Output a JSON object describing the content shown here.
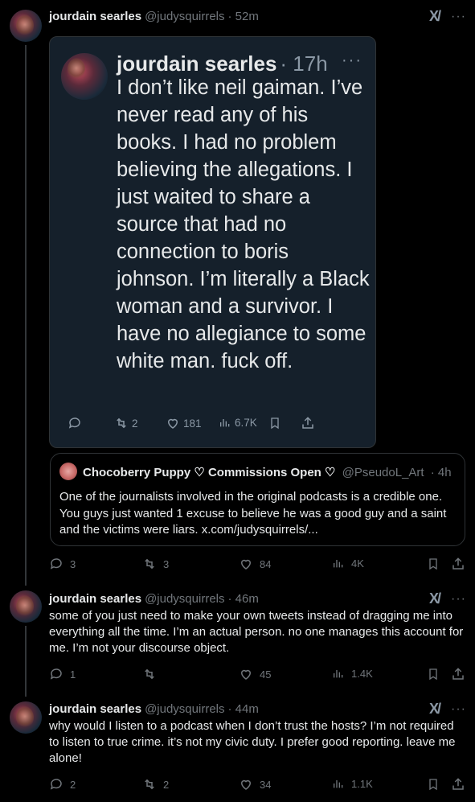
{
  "tweet1": {
    "name": "jourdain searles",
    "handle": "@judysquirrels",
    "time": "· 52m",
    "screenshot": {
      "name": "jourdain searles",
      "time": "· 17h",
      "text": "I don’t like neil gaiman. I’ve never read any of his books. I had no problem believing the allegations. I just waited to share a source that had no connection to boris johnson. I’m literally a Black woman and a survivor. I have no allegiance to some white man. fuck off.",
      "reposts": "2",
      "likes": "181",
      "views": "6.7K"
    },
    "quote": {
      "name": "Chocoberry Puppy ♡ Commissions Open ♡",
      "handle": "@PseudoL_Art",
      "time": "· 4h",
      "text": "One of the journalists involved in the original podcasts is a credible one. You guys just wanted 1 excuse to believe he was a good guy and a saint and the victims were liars. x.com/judysquirrels/..."
    },
    "replies": "3",
    "reposts": "3",
    "likes": "84",
    "views": "4K"
  },
  "tweet2": {
    "name": "jourdain searles",
    "handle": "@judysquirrels",
    "time": "· 46m",
    "text": "some of you just need to make your own tweets instead of dragging me into everything all the time. I’m an actual person. no one manages this account for me. I’m not your discourse object.",
    "replies": "1",
    "reposts": "",
    "likes": "45",
    "views": "1.4K"
  },
  "tweet3": {
    "name": "jourdain searles",
    "handle": "@judysquirrels",
    "time": "· 44m",
    "text": "why would I listen to a podcast when I don’t trust the hosts? I’m not required to listen to true crime. it’s not my civic duty. I prefer good reporting. leave me alone!",
    "replies": "2",
    "reposts": "2",
    "likes": "34",
    "views": "1.1K"
  },
  "icons": {
    "grok": "X/",
    "more": "···"
  }
}
